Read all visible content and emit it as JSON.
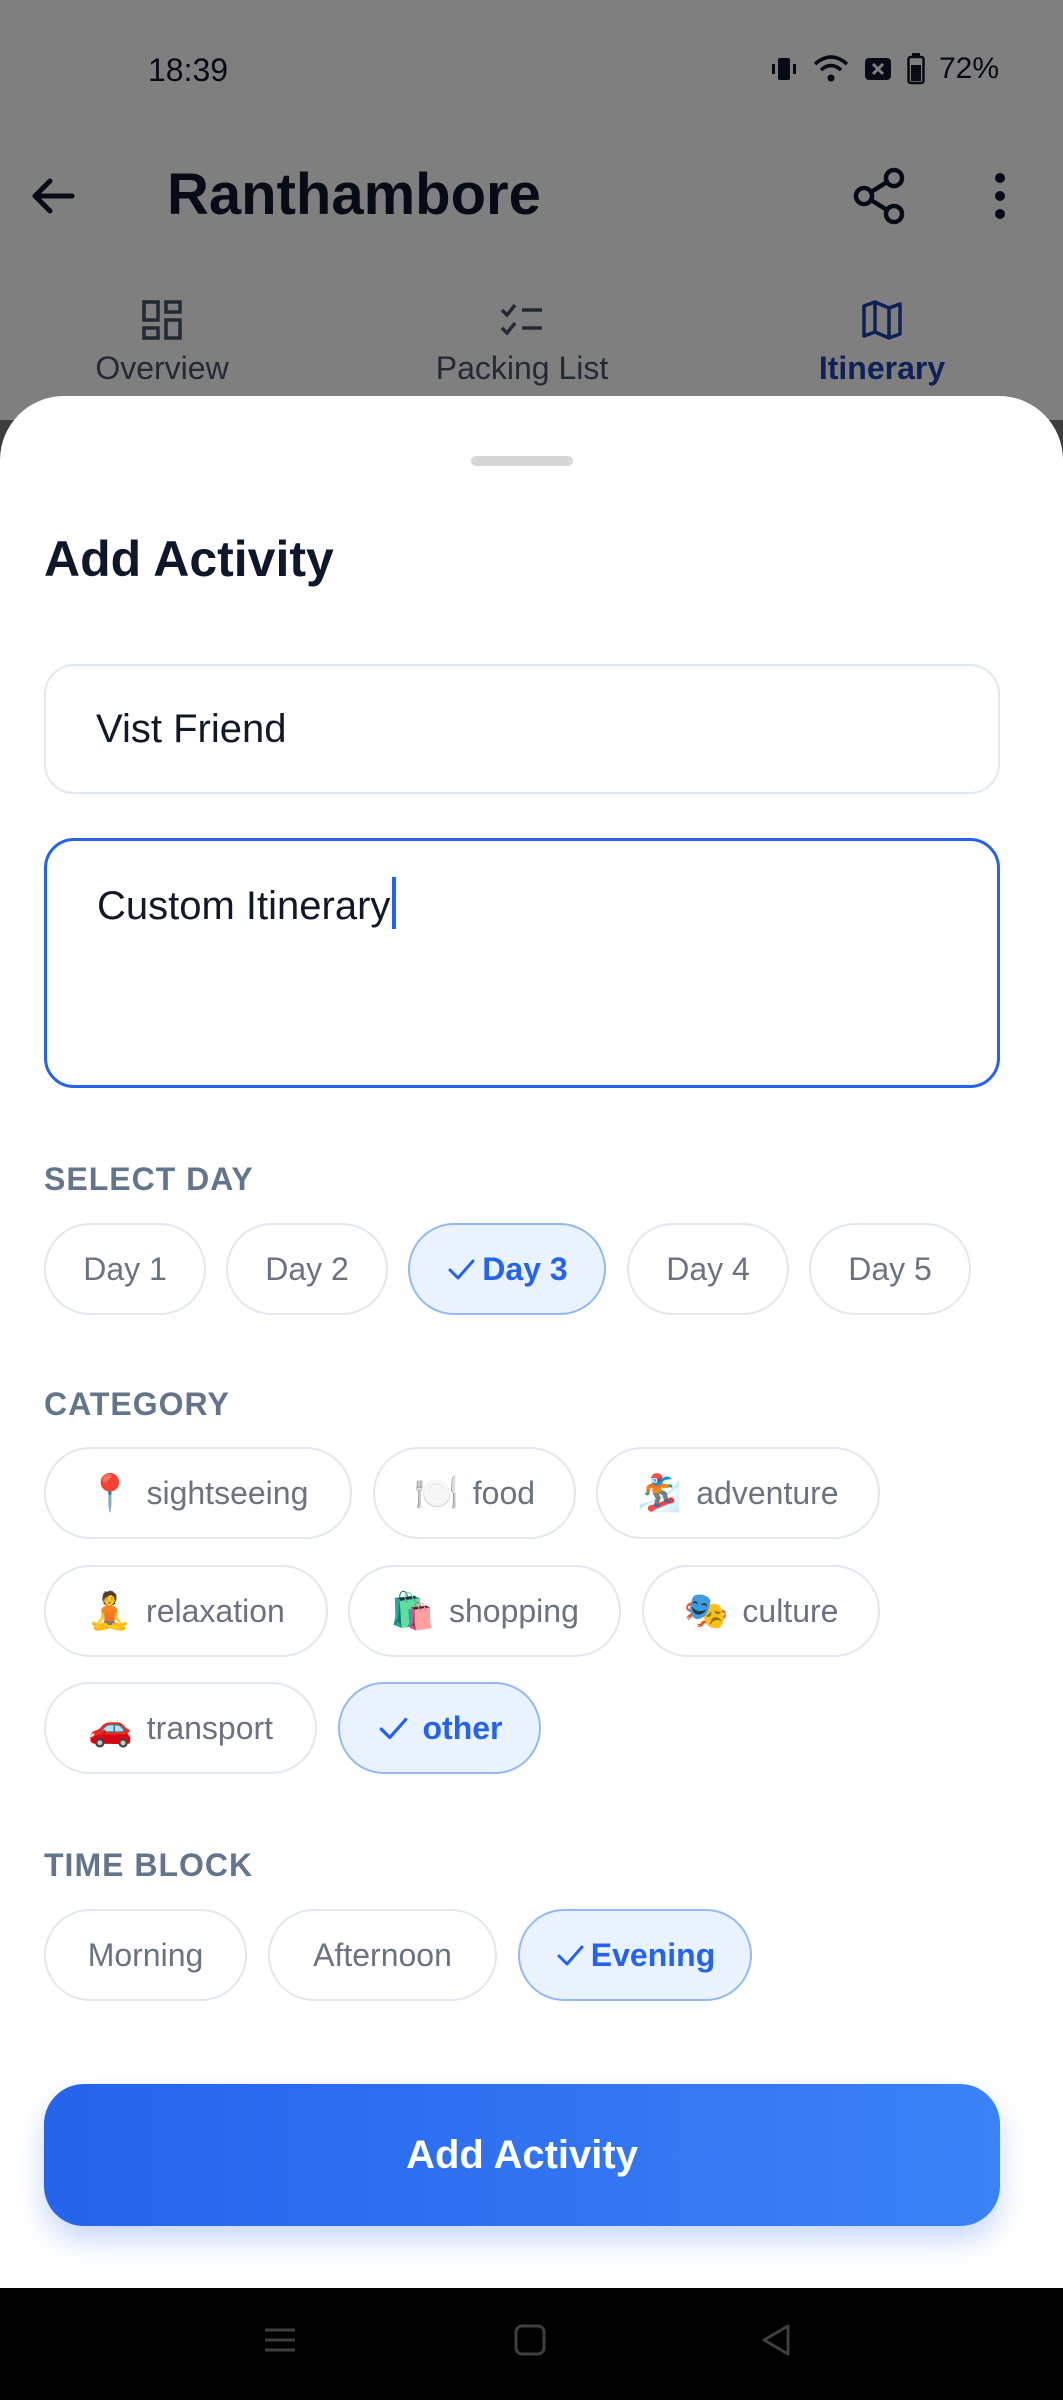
{
  "status_bar": {
    "time": "18:39",
    "battery": "72%",
    "icons": [
      "vibrate-icon",
      "wifi-icon",
      "notification-x-icon",
      "battery-icon"
    ]
  },
  "header": {
    "title": "Ranthambore",
    "icons": [
      "back-arrow-icon",
      "share-icon",
      "more-vertical-icon"
    ]
  },
  "tabs": [
    {
      "label": "Overview",
      "icon": "grid-icon",
      "active": false
    },
    {
      "label": "Packing List",
      "icon": "checklist-icon",
      "active": false
    },
    {
      "label": "Itinerary",
      "icon": "map-icon",
      "active": true
    }
  ],
  "sheet": {
    "title": "Add Activity",
    "title_input": {
      "value": "Vist Friend"
    },
    "description_input": {
      "value": "Custom Itinerary"
    },
    "day": {
      "label": "SELECT DAY",
      "options": [
        "Day 1",
        "Day 2",
        "Day 3",
        "Day 4",
        "Day 5"
      ],
      "selected": "Day 3"
    },
    "category": {
      "label": "CATEGORY",
      "options": [
        {
          "emoji": "📍",
          "label": "sightseeing"
        },
        {
          "emoji": "🍽️",
          "label": "food"
        },
        {
          "emoji": "🏂",
          "label": "adventure"
        },
        {
          "emoji": "🧘",
          "label": "relaxation"
        },
        {
          "emoji": "🛍️",
          "label": "shopping"
        },
        {
          "emoji": "🎭",
          "label": "culture"
        },
        {
          "emoji": "🚗",
          "label": "transport"
        },
        {
          "emoji": "",
          "label": "other"
        }
      ],
      "selected": "other"
    },
    "time_block": {
      "label": "TIME BLOCK",
      "options": [
        "Morning",
        "Afternoon",
        "Evening"
      ],
      "selected": "Evening"
    },
    "submit_label": "Add Activity"
  },
  "colors": {
    "accent": "#2563eb",
    "selected_bg": "#eaf2fe",
    "text_dark": "#0f172a",
    "label_gray": "#64748b"
  }
}
